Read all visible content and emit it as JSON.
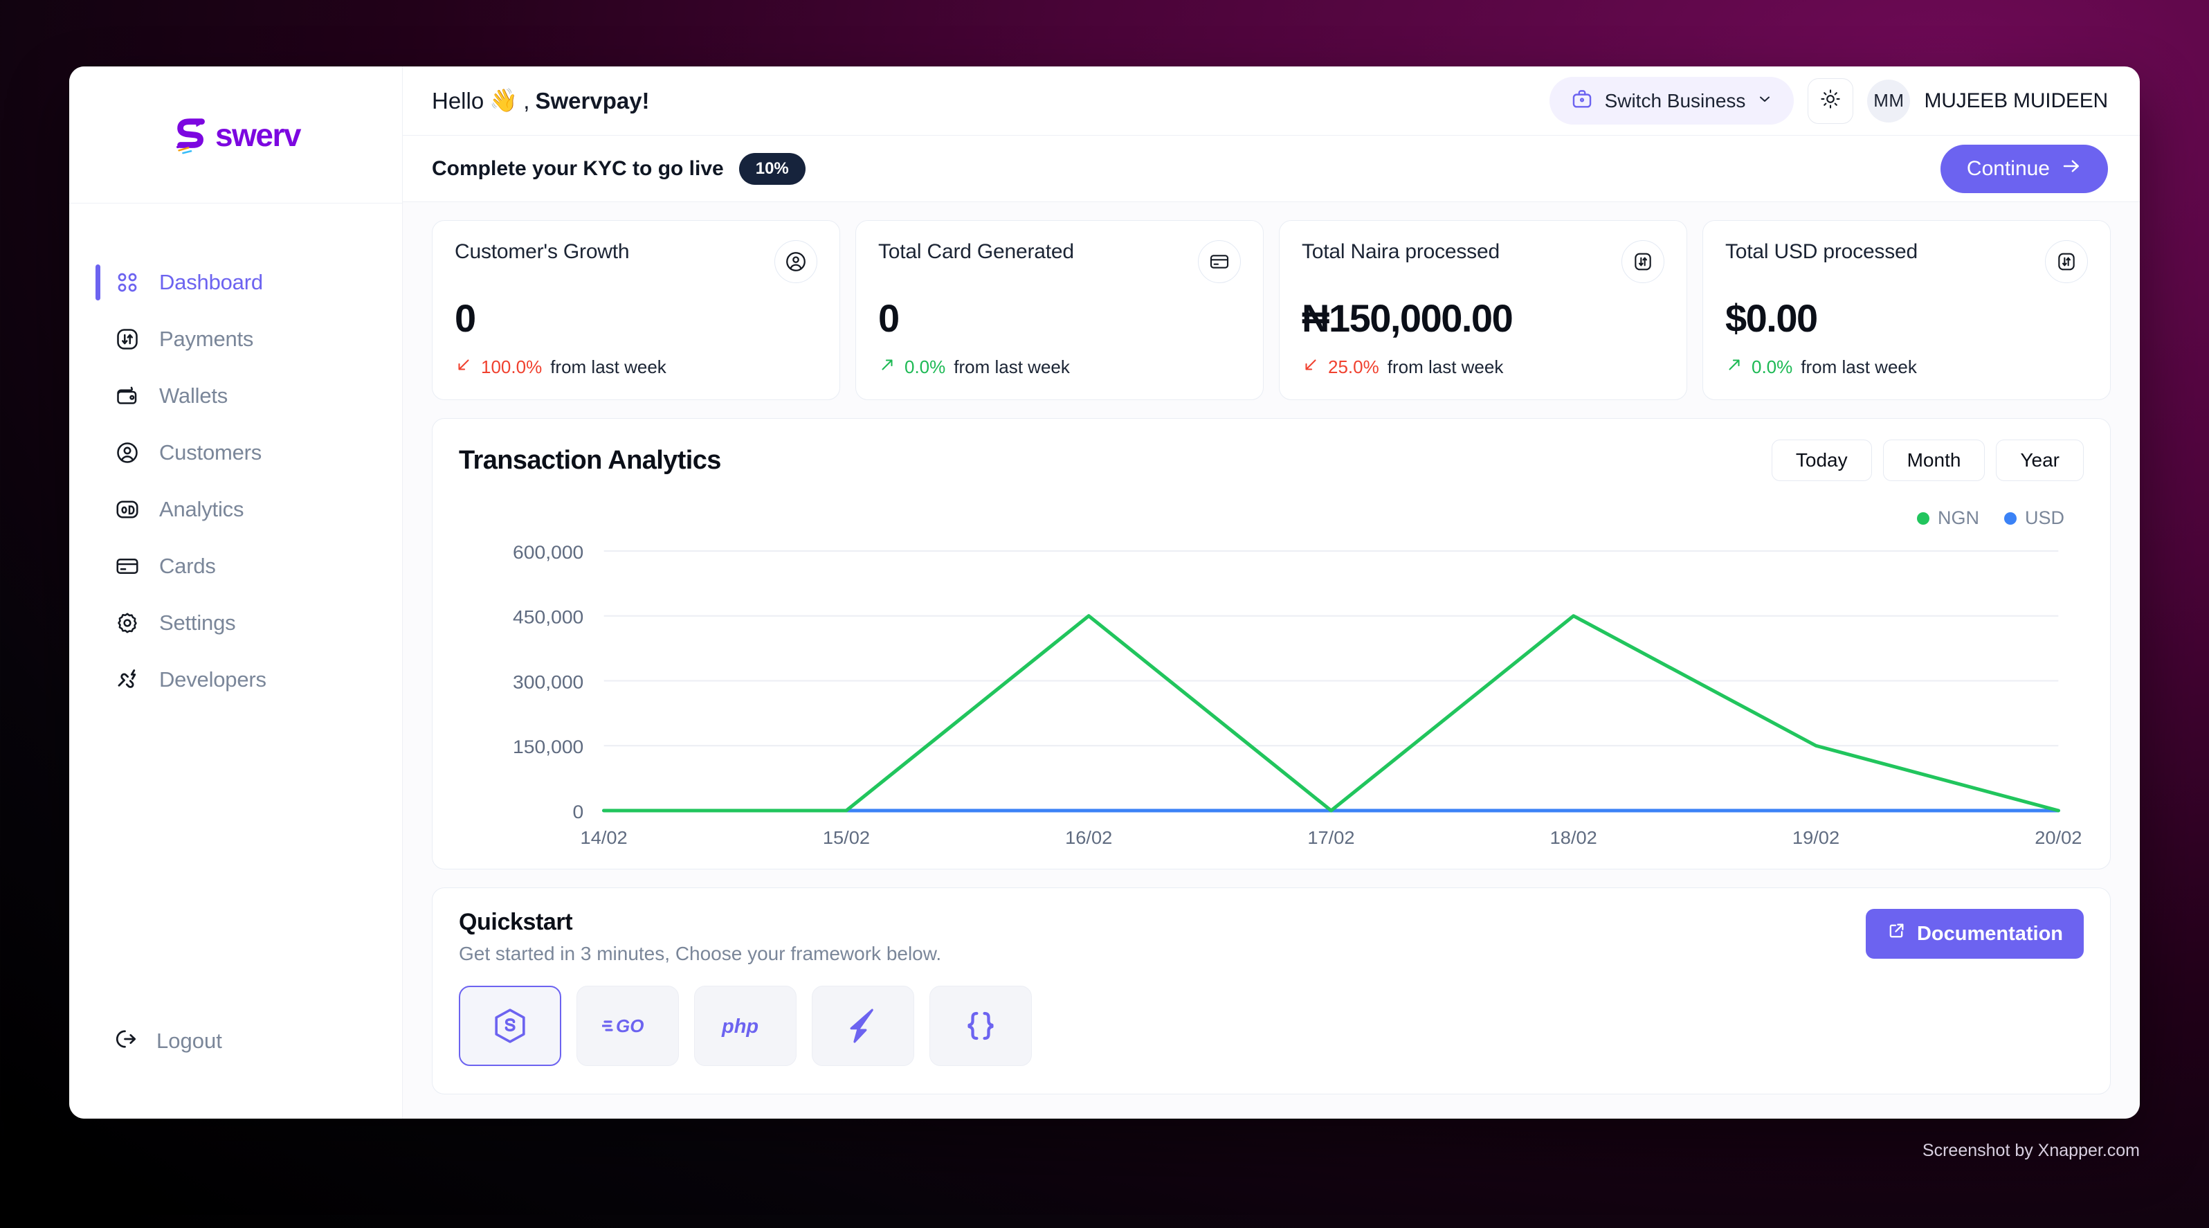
{
  "brand": {
    "name": "swerv",
    "color": "#7c07e0"
  },
  "sidebar": {
    "items": [
      {
        "label": "Dashboard",
        "icon": "grid-icon",
        "active": true
      },
      {
        "label": "Payments",
        "icon": "transfer-icon",
        "active": false
      },
      {
        "label": "Wallets",
        "icon": "wallet-icon",
        "active": false
      },
      {
        "label": "Customers",
        "icon": "user-circle-icon",
        "active": false
      },
      {
        "label": "Analytics",
        "icon": "analytics-icon",
        "active": false
      },
      {
        "label": "Cards",
        "icon": "card-icon",
        "active": false
      },
      {
        "label": "Settings",
        "icon": "gear-icon",
        "active": false
      },
      {
        "label": "Developers",
        "icon": "developers-icon",
        "active": false
      }
    ],
    "logout_label": "Logout"
  },
  "topbar": {
    "greeting_prefix": "Hello",
    "greeting_emoji": "👋",
    "greeting_comma": ",",
    "business_name": "Swervpay!",
    "switch_business_label": "Switch Business",
    "theme_icon": "sun-icon",
    "avatar_initials": "MM",
    "username": "MUJEEB MUIDEEN"
  },
  "kyc_banner": {
    "message": "Complete your KYC to go live",
    "progress_badge": "10%",
    "continue_label": "Continue"
  },
  "stats": [
    {
      "title": "Customer's Growth",
      "value": "0",
      "delta": "100.0%",
      "delta_suffix": "from last week",
      "direction": "down",
      "icon": "user-circle-icon"
    },
    {
      "title": "Total Card Generated",
      "value": "0",
      "delta": "0.0%",
      "delta_suffix": "from last week",
      "direction": "up",
      "icon": "card-icon"
    },
    {
      "title": "Total Naira processed",
      "value": "₦150,000.00",
      "delta": "25.0%",
      "delta_suffix": "from last week",
      "direction": "down",
      "icon": "transfer-icon"
    },
    {
      "title": "Total USD processed",
      "value": "$0.00",
      "delta": "0.0%",
      "delta_suffix": "from last week",
      "direction": "up",
      "icon": "transfer-icon"
    }
  ],
  "analytics": {
    "title": "Transaction Analytics",
    "periods": [
      "Today",
      "Month",
      "Year"
    ]
  },
  "chart_data": {
    "type": "line",
    "title": "Transaction Analytics",
    "xlabel": "",
    "ylabel": "",
    "x": [
      "14/02",
      "15/02",
      "16/02",
      "17/02",
      "18/02",
      "19/02",
      "20/02"
    ],
    "yticks": [
      0,
      150000,
      300000,
      450000,
      600000
    ],
    "ytick_labels": [
      "0",
      "150,000",
      "300,000",
      "450,000",
      "600,000"
    ],
    "ylim": [
      0,
      650000
    ],
    "grid": true,
    "legend_position": "top-right",
    "series": [
      {
        "name": "NGN",
        "color": "#21c55d",
        "values": [
          0,
          0,
          450000,
          0,
          450000,
          150000,
          0
        ]
      },
      {
        "name": "USD",
        "color": "#3b82f6",
        "values": [
          0,
          0,
          0,
          0,
          0,
          0,
          0
        ]
      }
    ]
  },
  "quickstart": {
    "title": "Quickstart",
    "subtitle": "Get started in 3 minutes, Choose your framework below.",
    "documentation_label": "Documentation",
    "frameworks": [
      {
        "name": "nodejs",
        "selected": true
      },
      {
        "name": "go",
        "selected": false
      },
      {
        "name": "php",
        "selected": false
      },
      {
        "name": "laravel",
        "selected": false
      },
      {
        "name": "json",
        "selected": false
      }
    ]
  },
  "watermark": "Screenshot by Xnapper.com"
}
